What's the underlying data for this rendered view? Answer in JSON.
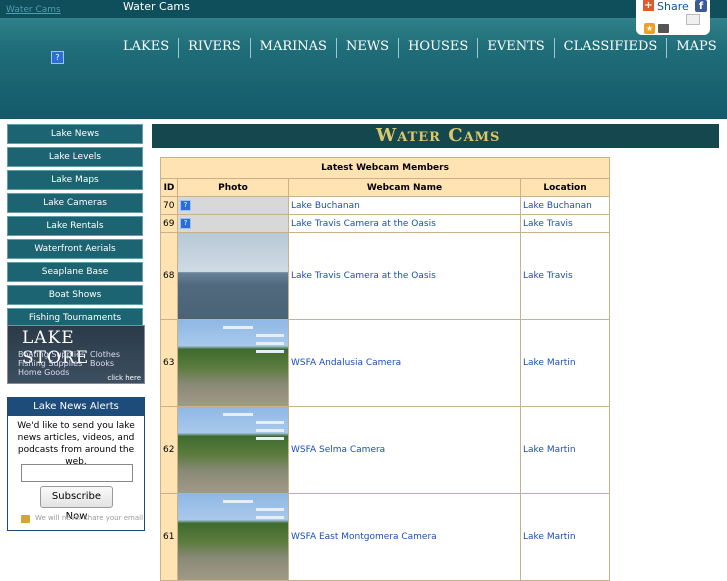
{
  "header": {
    "site_link": "Water Cams",
    "page_tab": "Water Cams",
    "share_label": "Share",
    "nav": [
      "LAKES",
      "RIVERS",
      "MARINAS",
      "NEWS",
      "HOUSES",
      "EVENTS",
      "CLASSIFIEDS",
      "MAPS"
    ]
  },
  "sidebar": {
    "links": [
      "Lake News",
      "Lake Levels",
      "Lake Maps",
      "Lake Cameras",
      "Lake Rentals",
      "Waterfront Aerials",
      "Seaplane Base",
      "Boat Shows",
      "Fishing Tournaments"
    ],
    "store": {
      "title": "LAKE STORE",
      "items": [
        "Boating Supplies",
        "Clothes",
        "Fishing Supplies",
        "Books",
        "Home Goods"
      ],
      "click_here": "click here"
    },
    "alerts": {
      "title": "Lake News Alerts",
      "text": "We'd like to send you lake news articles, videos, and podcasts from around the web.",
      "button": "Subscribe Now",
      "privacy": "We will never share your email"
    }
  },
  "main": {
    "title": "Water Cams",
    "table": {
      "caption": "Latest Webcam Members",
      "headers": [
        "ID",
        "Photo",
        "Webcam Name",
        "Location"
      ],
      "rows": [
        {
          "id": "70",
          "name": "Lake Buchanan",
          "location": "Lake Buchanan"
        },
        {
          "id": "69",
          "name": "Lake Travis Camera at the Oasis",
          "location": "Lake Travis"
        },
        {
          "id": "68",
          "name": "Lake Travis Camera at the Oasis",
          "location": "Lake Travis"
        },
        {
          "id": "63",
          "name": "WSFA Andalusia Camera",
          "location": "Lake Martin"
        },
        {
          "id": "62",
          "name": "WSFA Selma Camera",
          "location": "Lake Martin"
        },
        {
          "id": "61",
          "name": "WSFA East Montgomera Camera",
          "location": "Lake Martin"
        }
      ]
    }
  },
  "colors": {
    "header_teal": "#1f6e79",
    "title_bar": "#15474f",
    "title_text": "#d8c86a",
    "table_bg": "#ffe3b3",
    "link": "#1a4fb4"
  }
}
